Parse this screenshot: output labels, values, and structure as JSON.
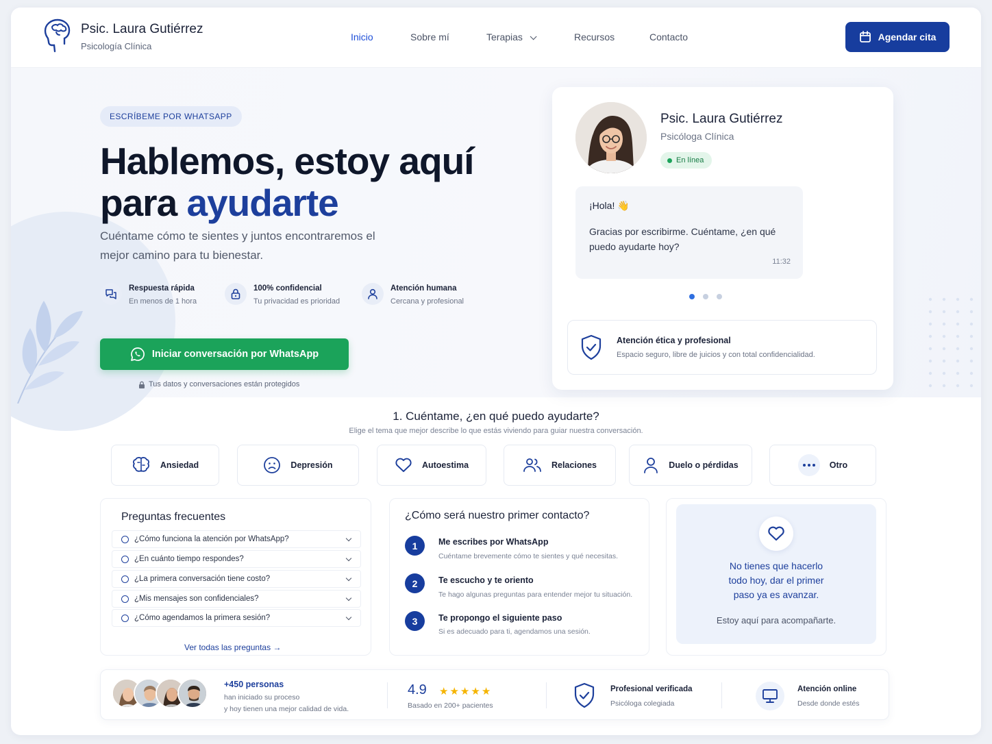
{
  "header": {
    "brand_name": "Psic. Laura Gutiérrez",
    "brand_sub": "Psicología Clínica",
    "nav": [
      "Inicio",
      "Sobre mí",
      "Terapias",
      "Recursos",
      "Contacto"
    ],
    "cta": "Agendar cita"
  },
  "hero": {
    "pill": "ESCRÍBEME POR WHATSAPP",
    "title_line1": "Hablemos, estoy aquí",
    "title_line2_a": "para ",
    "title_line2_b": "ayudarte",
    "lead": "Cuéntame cómo te sientes y juntos encontraremos el mejor camino para tu bienestar.",
    "features": [
      {
        "title": "Respuesta rápida",
        "sub": "En menos de 1 hora",
        "icon": "chat-bubbles-icon"
      },
      {
        "title": "100% confidencial",
        "sub": "Tu privacidad es prioridad",
        "icon": "lock-icon"
      },
      {
        "title": "Atención humana",
        "sub": "Cercana y profesional",
        "icon": "person-icon"
      }
    ],
    "whatsapp_button": "Iniciar conversación por WhatsApp",
    "privacy_note": "Tus datos y conversaciones están protegidos"
  },
  "profile_card": {
    "name": "Psic. Laura Gutiérrez",
    "role": "Psicóloga Clínica",
    "status": "En línea",
    "message_greeting": "¡Hola! 👋",
    "message_body": "Gracias por escribirme. Cuéntame, ¿en qué puedo ayudarte hoy?",
    "message_time": "11:32",
    "ethics_title": "Atención ética y profesional",
    "ethics_sub": "Espacio seguro, libre de juicios y con total confidencialidad."
  },
  "topics": {
    "title": "1. Cuéntame, ¿en qué puedo ayudarte?",
    "subtitle": "Elige el tema que mejor describe lo que estás viviendo para guiar nuestra conversación.",
    "items": [
      "Ansiedad",
      "Depresión",
      "Autoestima",
      "Relaciones",
      "Duelo o pérdidas",
      "Otro"
    ]
  },
  "faq": {
    "title": "Preguntas frecuentes",
    "items": [
      "¿Cómo funciona la atención por WhatsApp?",
      "¿En cuánto tiempo respondes?",
      "¿La primera conversación tiene costo?",
      "¿Mis mensajes son confidenciales?",
      "¿Cómo agendamos la primera sesión?"
    ],
    "link": "Ver todas las preguntas"
  },
  "steps": {
    "title": "¿Cómo será nuestro primer contacto?",
    "items": [
      {
        "n": "1",
        "title": "Me escribes por WhatsApp",
        "sub": "Cuéntame brevemente cómo te sientes y qué necesitas."
      },
      {
        "n": "2",
        "title": "Te escucho y te oriento",
        "sub": "Te hago algunas preguntas para entender mejor tu situación."
      },
      {
        "n": "3",
        "title": "Te propongo el siguiente paso",
        "sub": "Si es adecuado para ti, agendamos una sesión."
      }
    ]
  },
  "encourage": {
    "text": "No tienes que hacerlo todo hoy, dar el primer paso ya es avanzar.",
    "sub": "Estoy aquí para acompañarte."
  },
  "trust": {
    "people_count": "+450 personas",
    "people_sub1": "han iniciado su proceso",
    "people_sub2": "y hoy tienen una mejor calidad de vida.",
    "rating": "4.9",
    "rating_stars": 5,
    "rating_sub": "Basado en 200+ pacientes",
    "verified_title": "Profesional verificada",
    "verified_sub": "Psicóloga colegiada",
    "online_title": "Atención online",
    "online_sub": "Desde donde estés"
  },
  "colors": {
    "primary": "#173d9e",
    "accent_text": "#1d3f9c",
    "whatsapp_green": "#1ba35a",
    "star": "#f5b400"
  }
}
